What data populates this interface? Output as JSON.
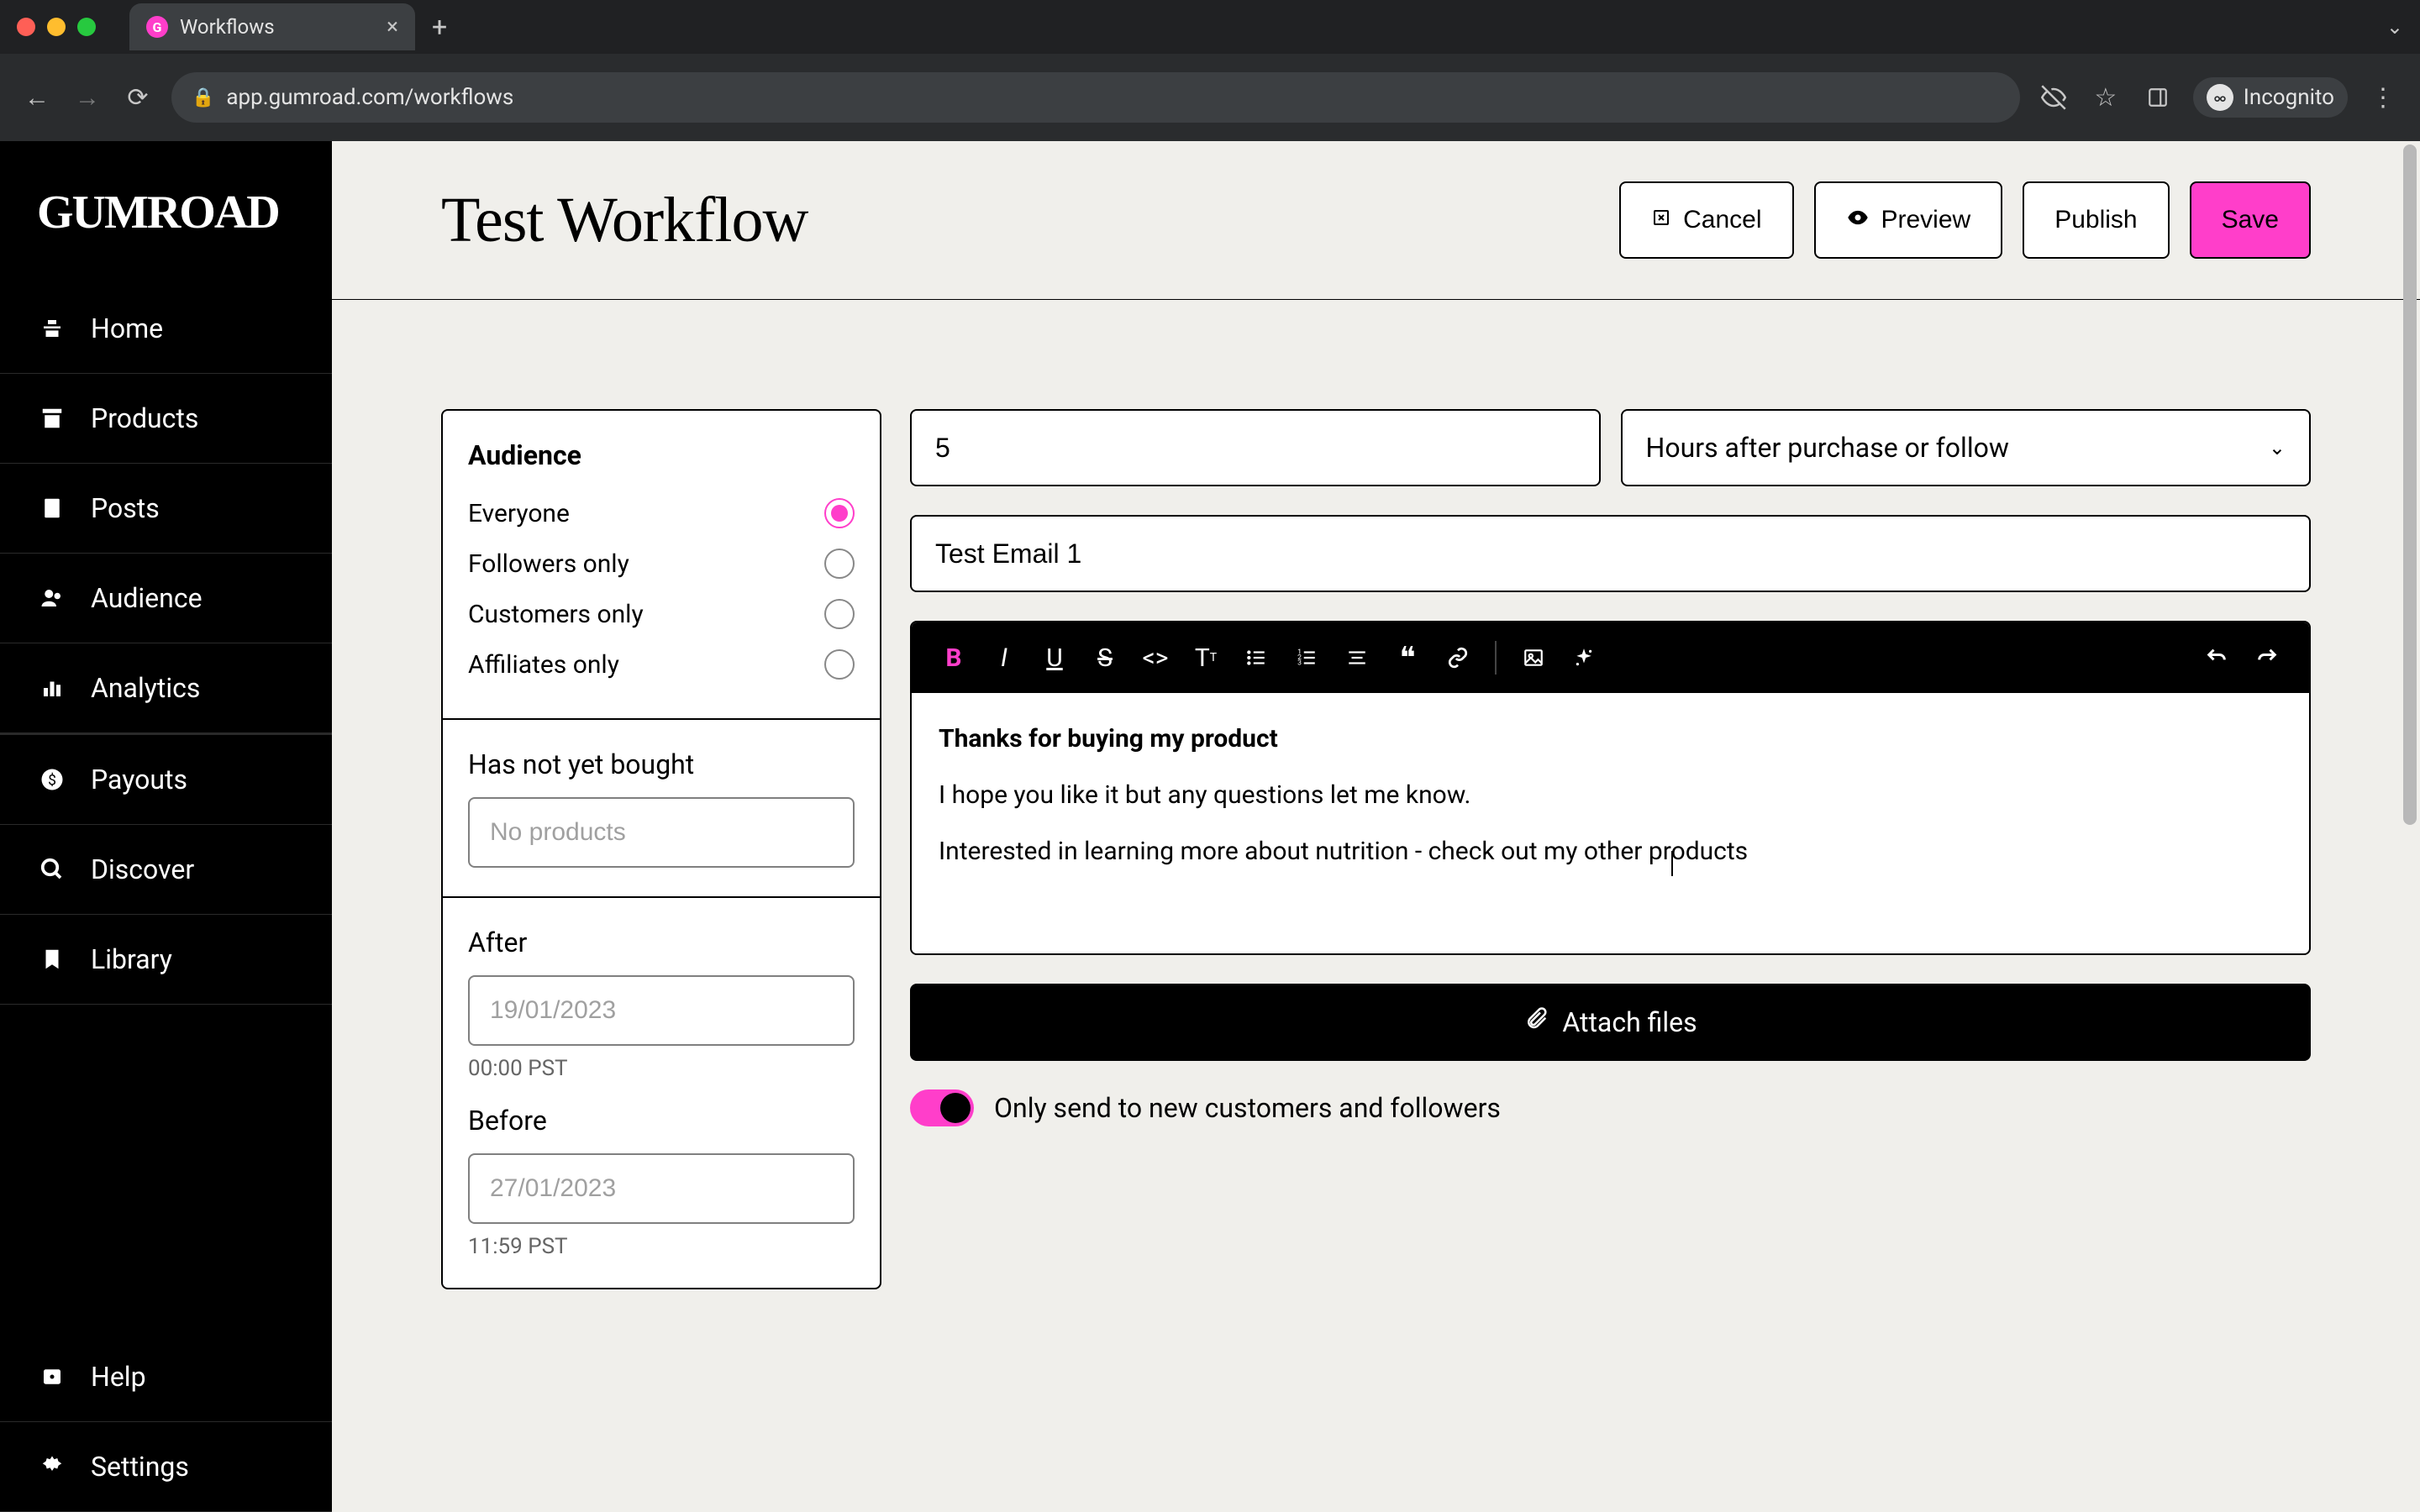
{
  "browser": {
    "tab_title": "Workflows",
    "url": "app.gumroad.com/workflows",
    "incognito_label": "Incognito"
  },
  "sidebar": {
    "logo": "GUMROAD",
    "items": [
      {
        "icon": "home",
        "label": "Home"
      },
      {
        "icon": "products",
        "label": "Products"
      },
      {
        "icon": "posts",
        "label": "Posts"
      },
      {
        "icon": "audience",
        "label": "Audience"
      },
      {
        "icon": "analytics",
        "label": "Analytics"
      },
      {
        "icon": "payouts",
        "label": "Payouts"
      },
      {
        "icon": "discover",
        "label": "Discover"
      },
      {
        "icon": "library",
        "label": "Library"
      }
    ],
    "bottom_items": [
      {
        "icon": "help",
        "label": "Help"
      },
      {
        "icon": "settings",
        "label": "Settings"
      }
    ]
  },
  "header": {
    "title": "Test Workflow",
    "actions": {
      "cancel": "Cancel",
      "preview": "Preview",
      "publish": "Publish",
      "save": "Save"
    }
  },
  "audience_panel": {
    "title": "Audience",
    "options": [
      {
        "label": "Everyone",
        "checked": true
      },
      {
        "label": "Followers only",
        "checked": false
      },
      {
        "label": "Customers only",
        "checked": false
      },
      {
        "label": "Affiliates only",
        "checked": false
      }
    ],
    "not_bought": {
      "label": "Has not yet bought",
      "placeholder": "No products"
    },
    "after": {
      "label": "After",
      "placeholder": "19/01/2023",
      "time_note": "00:00 PST"
    },
    "before": {
      "label": "Before",
      "placeholder": "27/01/2023",
      "time_note": "11:59 PST"
    }
  },
  "email": {
    "delay_value": "5",
    "delay_unit": "Hours after purchase or follow",
    "subject": "Test Email 1",
    "body": {
      "line1": "Thanks for buying my product",
      "line2": "I hope you like it but any questions let me know.",
      "line3": "Interested in learning more about nutrition - check out my other products"
    },
    "attach_label": "Attach files",
    "toggle_label": "Only send to new customers and followers",
    "toggle_on": true
  }
}
